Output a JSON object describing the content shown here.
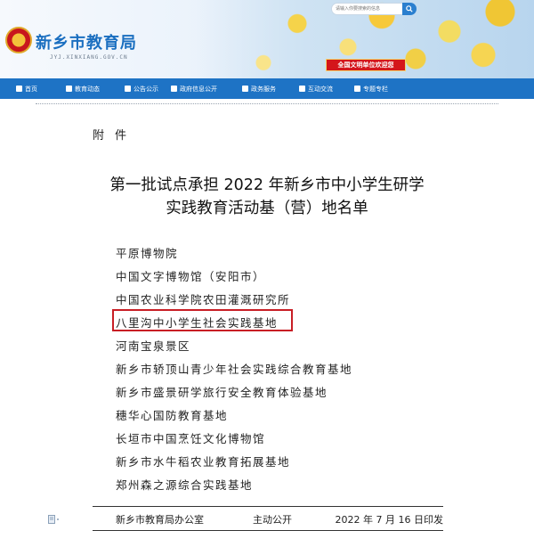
{
  "header": {
    "site_title": "新乡市教育局",
    "site_domain": "JYJ.XINXIANG.GOV.CN",
    "search": {
      "placeholder": "请输入你要搜索的信息"
    },
    "civil_badge": "全国文明单位欢迎您"
  },
  "nav": {
    "items": [
      {
        "label": "首页",
        "icon": "home-icon"
      },
      {
        "label": "教育动态",
        "icon": "news-icon"
      },
      {
        "label": "公告公示",
        "icon": "notice-icon"
      },
      {
        "label": "政府信息公开",
        "icon": "speaker-icon"
      },
      {
        "label": "政务服务",
        "icon": "service-icon"
      },
      {
        "label": "互动交流",
        "icon": "chat-icon"
      },
      {
        "label": "专题专栏",
        "icon": "folder-icon"
      }
    ]
  },
  "doc": {
    "attachment_label": "附件",
    "title_line1": "第一批试点承担 2022 年新乡市中小学生研学",
    "title_line2": "实践教育活动基（营）地名单",
    "entries": [
      "平原博物院",
      "中国文字博物馆（安阳市）",
      "中国农业科学院农田灌溉研究所",
      "八里沟中小学生社会实践基地",
      "河南宝泉景区",
      "新乡市轿顶山青少年社会实践综合教育基地",
      "新乡市盛景研学旅行安全教育体验基地",
      "穗华心国防教育基地",
      "长垣市中国烹饪文化博物馆",
      "新乡市水牛稻农业教育拓展基地",
      "郑州森之源综合实践基地"
    ],
    "highlighted_entry_index": 3,
    "highlight_color": "#c81e25"
  },
  "footer": {
    "office": "新乡市教育局办公室",
    "disclosure": "主动公开",
    "date": "2022 年 7 月 16 日印发"
  },
  "colors": {
    "nav_bg": "#1e73c5",
    "title_blue": "#1b6fc0",
    "badge_red": "#d4161b"
  }
}
